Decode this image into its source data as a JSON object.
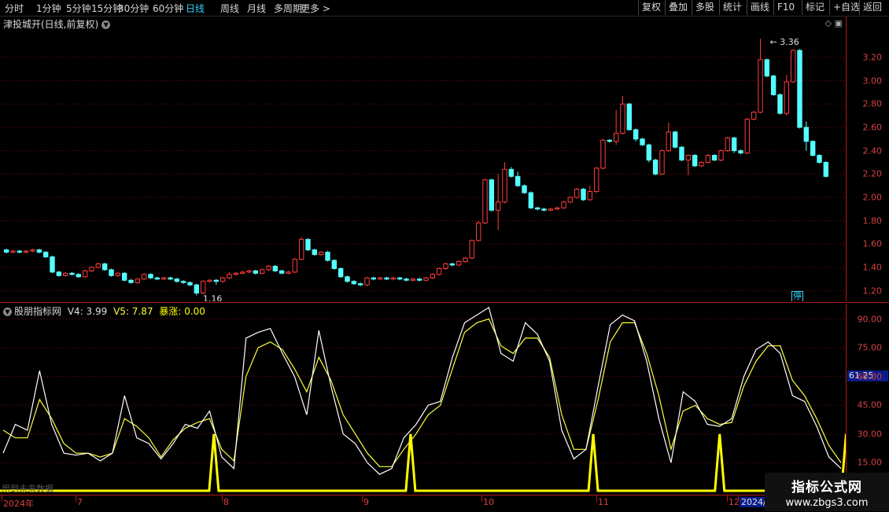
{
  "toolbar": {
    "periods": [
      "分时",
      "1分钟",
      "5分钟",
      "15分钟",
      "30分钟",
      "60分钟",
      "日线",
      "周线",
      "月线",
      "多周期",
      "更多 >"
    ],
    "active_period": "日线",
    "tools": [
      "复权",
      "叠加",
      "多股",
      "统计",
      "画线",
      "F10",
      "标记",
      "+自选",
      "返回"
    ]
  },
  "price_pane": {
    "stock_title": "津投城开(日线,前复权)",
    "stop_badge": "停",
    "high_label": "3.36",
    "low_label": "1.16",
    "icons": {
      "diamond": "diamond-icon",
      "window": "window-icon",
      "collapse": "chevron-down-icon"
    }
  },
  "price_axis": {
    "ticks": [
      "3.20",
      "3.00",
      "2.80",
      "2.60",
      "2.40",
      "2.20",
      "2.00",
      "1.80",
      "1.60",
      "1.40",
      "1.20"
    ],
    "tick_values": [
      3.2,
      3.0,
      2.8,
      2.6,
      2.4,
      2.2,
      2.0,
      1.8,
      1.6,
      1.4,
      1.2
    ],
    "range": [
      1.11,
      3.55
    ]
  },
  "indicator": {
    "name": "股朋指标网",
    "v4_label": "V4: 3.99",
    "v5_label": "V5: 7.87",
    "spike_label": "暴涨: 0.00",
    "footer_text": "用到未来数据",
    "current_value": "61.25",
    "ticks": [
      "90.00",
      "75.00",
      "60.00",
      "45.00",
      "30.00",
      "15.00"
    ],
    "tick_values": [
      90,
      75,
      60,
      45,
      30,
      15
    ],
    "range": [
      0,
      98
    ]
  },
  "dates": {
    "labels": [
      "2024年",
      "7",
      "8",
      "9",
      "10",
      "11",
      "12",
      "2024/"
    ],
    "positions_index": [
      0,
      19,
      56,
      91,
      124,
      160,
      198,
      200
    ]
  },
  "watermark": {
    "line1": "指标公式网",
    "line2": "www.zbgs3.com"
  },
  "colors": {
    "up": "#ff3c3c",
    "down": "#54ffff",
    "grid": "#7a0d0d",
    "axis_text": "#d84040",
    "white_line": "#ffffff",
    "yellow_line": "#ffff3a",
    "spike": "#ffff00",
    "active": "#38d4ff"
  },
  "chart_data": {
    "type": "candlestick",
    "title": "津投城开(日线,前复权)",
    "ylim": [
      1.11,
      3.55
    ],
    "candles": [
      [
        1.55,
        1.53,
        1.56,
        1.52
      ],
      [
        1.53,
        1.54,
        1.55,
        1.52
      ],
      [
        1.54,
        1.53,
        1.55,
        1.52
      ],
      [
        1.53,
        1.54,
        1.55,
        1.52
      ],
      [
        1.54,
        1.55,
        1.56,
        1.53
      ],
      [
        1.55,
        1.53,
        1.56,
        1.52
      ],
      [
        1.53,
        1.49,
        1.54,
        1.48
      ],
      [
        1.49,
        1.36,
        1.5,
        1.35
      ],
      [
        1.36,
        1.33,
        1.37,
        1.32
      ],
      [
        1.33,
        1.35,
        1.36,
        1.32
      ],
      [
        1.35,
        1.34,
        1.36,
        1.33
      ],
      [
        1.34,
        1.32,
        1.35,
        1.31
      ],
      [
        1.32,
        1.37,
        1.38,
        1.31
      ],
      [
        1.37,
        1.4,
        1.41,
        1.36
      ],
      [
        1.4,
        1.43,
        1.44,
        1.39
      ],
      [
        1.43,
        1.38,
        1.44,
        1.37
      ],
      [
        1.38,
        1.33,
        1.39,
        1.32
      ],
      [
        1.33,
        1.35,
        1.36,
        1.32
      ],
      [
        1.35,
        1.29,
        1.36,
        1.28
      ],
      [
        1.29,
        1.27,
        1.3,
        1.26
      ],
      [
        1.27,
        1.3,
        1.31,
        1.26
      ],
      [
        1.3,
        1.34,
        1.35,
        1.29
      ],
      [
        1.34,
        1.31,
        1.35,
        1.3
      ],
      [
        1.31,
        1.3,
        1.32,
        1.29
      ],
      [
        1.3,
        1.31,
        1.32,
        1.29
      ],
      [
        1.31,
        1.3,
        1.32,
        1.29
      ],
      [
        1.3,
        1.28,
        1.31,
        1.27
      ],
      [
        1.28,
        1.27,
        1.29,
        1.26
      ],
      [
        1.27,
        1.25,
        1.28,
        1.24
      ],
      [
        1.25,
        1.18,
        1.26,
        1.16
      ],
      [
        1.18,
        1.28,
        1.29,
        1.17
      ],
      [
        1.28,
        1.29,
        1.3,
        1.27
      ],
      [
        1.29,
        1.28,
        1.3,
        1.25
      ],
      [
        1.28,
        1.31,
        1.32,
        1.27
      ],
      [
        1.31,
        1.34,
        1.36,
        1.3
      ],
      [
        1.34,
        1.35,
        1.36,
        1.33
      ],
      [
        1.35,
        1.36,
        1.37,
        1.34
      ],
      [
        1.36,
        1.37,
        1.38,
        1.35
      ],
      [
        1.37,
        1.35,
        1.38,
        1.34
      ],
      [
        1.35,
        1.38,
        1.39,
        1.34
      ],
      [
        1.38,
        1.41,
        1.42,
        1.37
      ],
      [
        1.41,
        1.37,
        1.42,
        1.36
      ],
      [
        1.37,
        1.35,
        1.38,
        1.34
      ],
      [
        1.35,
        1.36,
        1.37,
        1.34
      ],
      [
        1.36,
        1.47,
        1.48,
        1.35
      ],
      [
        1.47,
        1.64,
        1.66,
        1.46
      ],
      [
        1.64,
        1.55,
        1.65,
        1.54
      ],
      [
        1.55,
        1.51,
        1.56,
        1.5
      ],
      [
        1.51,
        1.53,
        1.54,
        1.5
      ],
      [
        1.53,
        1.46,
        1.54,
        1.45
      ],
      [
        1.46,
        1.39,
        1.47,
        1.38
      ],
      [
        1.39,
        1.32,
        1.4,
        1.31
      ],
      [
        1.32,
        1.28,
        1.33,
        1.27
      ],
      [
        1.28,
        1.26,
        1.29,
        1.25
      ],
      [
        1.26,
        1.25,
        1.27,
        1.24
      ],
      [
        1.25,
        1.31,
        1.32,
        1.24
      ],
      [
        1.31,
        1.3,
        1.32,
        1.29
      ],
      [
        1.3,
        1.31,
        1.32,
        1.29
      ],
      [
        1.31,
        1.3,
        1.32,
        1.29
      ],
      [
        1.3,
        1.31,
        1.32,
        1.29
      ],
      [
        1.31,
        1.3,
        1.32,
        1.29
      ],
      [
        1.3,
        1.29,
        1.31,
        1.28
      ],
      [
        1.29,
        1.3,
        1.31,
        1.28
      ],
      [
        1.3,
        1.29,
        1.31,
        1.28
      ],
      [
        1.29,
        1.31,
        1.32,
        1.28
      ],
      [
        1.31,
        1.34,
        1.35,
        1.3
      ],
      [
        1.34,
        1.39,
        1.4,
        1.33
      ],
      [
        1.39,
        1.43,
        1.44,
        1.38
      ],
      [
        1.43,
        1.42,
        1.44,
        1.41
      ],
      [
        1.42,
        1.45,
        1.46,
        1.41
      ],
      [
        1.45,
        1.48,
        1.49,
        1.44
      ],
      [
        1.48,
        1.63,
        1.64,
        1.47
      ],
      [
        1.63,
        1.78,
        1.8,
        1.62
      ],
      [
        1.78,
        2.15,
        2.16,
        1.77
      ],
      [
        2.15,
        1.89,
        2.16,
        1.88
      ],
      [
        1.89,
        1.96,
        2.2,
        1.72
      ],
      [
        1.96,
        2.24,
        2.3,
        1.95
      ],
      [
        2.24,
        2.18,
        2.26,
        2.17
      ],
      [
        2.18,
        2.1,
        2.22,
        2.09
      ],
      [
        2.1,
        2.04,
        2.11,
        2.03
      ],
      [
        2.04,
        1.91,
        2.05,
        1.9
      ],
      [
        1.91,
        1.9,
        1.92,
        1.89
      ],
      [
        1.9,
        1.89,
        1.91,
        1.88
      ],
      [
        1.89,
        1.9,
        1.91,
        1.88
      ],
      [
        1.9,
        1.91,
        1.92,
        1.89
      ],
      [
        1.91,
        1.96,
        1.97,
        1.9
      ],
      [
        1.96,
        2.0,
        2.01,
        1.95
      ],
      [
        2.0,
        2.07,
        2.08,
        1.99
      ],
      [
        2.07,
        1.98,
        2.08,
        1.97
      ],
      [
        1.98,
        2.05,
        2.1,
        1.97
      ],
      [
        2.05,
        2.25,
        2.26,
        2.04
      ],
      [
        2.25,
        2.49,
        2.5,
        2.24
      ],
      [
        2.49,
        2.48,
        2.5,
        2.47
      ],
      [
        2.48,
        2.55,
        2.75,
        2.45
      ],
      [
        2.55,
        2.8,
        2.87,
        2.54
      ],
      [
        2.8,
        2.58,
        2.81,
        2.57
      ],
      [
        2.58,
        2.5,
        2.59,
        2.48
      ],
      [
        2.5,
        2.45,
        2.51,
        2.44
      ],
      [
        2.45,
        2.32,
        2.46,
        2.3
      ],
      [
        2.32,
        2.2,
        2.33,
        2.19
      ],
      [
        2.2,
        2.4,
        2.41,
        2.19
      ],
      [
        2.4,
        2.56,
        2.64,
        2.39
      ],
      [
        2.56,
        2.43,
        2.57,
        2.42
      ],
      [
        2.43,
        2.32,
        2.44,
        2.31
      ],
      [
        2.32,
        2.36,
        2.37,
        2.19
      ],
      [
        2.36,
        2.27,
        2.37,
        2.26
      ],
      [
        2.27,
        2.3,
        2.31,
        2.26
      ],
      [
        2.3,
        2.36,
        2.37,
        2.29
      ],
      [
        2.36,
        2.32,
        2.37,
        2.31
      ],
      [
        2.32,
        2.4,
        2.41,
        2.31
      ],
      [
        2.4,
        2.51,
        2.52,
        2.39
      ],
      [
        2.51,
        2.4,
        2.52,
        2.38
      ],
      [
        2.4,
        2.38,
        2.41,
        2.37
      ],
      [
        2.38,
        2.67,
        2.68,
        2.37
      ],
      [
        2.67,
        2.73,
        2.74,
        2.66
      ],
      [
        2.73,
        3.18,
        3.36,
        2.72
      ],
      [
        3.18,
        3.04,
        3.19,
        3.03
      ],
      [
        3.04,
        2.88,
        3.05,
        2.87
      ],
      [
        2.88,
        2.72,
        2.89,
        2.71
      ],
      [
        2.72,
        2.99,
        3.05,
        2.7
      ],
      [
        2.99,
        3.26,
        3.27,
        2.98
      ],
      [
        3.26,
        2.6,
        3.27,
        2.59
      ],
      [
        2.6,
        2.48,
        2.65,
        2.4
      ],
      [
        2.48,
        2.36,
        2.49,
        2.35
      ],
      [
        2.36,
        2.3,
        2.37,
        2.29
      ],
      [
        2.3,
        2.18,
        2.31,
        2.17
      ]
    ],
    "indicator_series": [
      {
        "name": "V4",
        "color": "white",
        "values": [
          20,
          35,
          32,
          63,
          35,
          20,
          19,
          20,
          16,
          20,
          50,
          28,
          25,
          17,
          25,
          35,
          33,
          42,
          18,
          12,
          80,
          83,
          85,
          72,
          60,
          40,
          84,
          55,
          30,
          25,
          15,
          9,
          12,
          28,
          35,
          45,
          47,
          70,
          88,
          92,
          96,
          72,
          68,
          88,
          82,
          68,
          32,
          17,
          22,
          55,
          87,
          92,
          89,
          68,
          38,
          15,
          52,
          47,
          35,
          34,
          38,
          60,
          74,
          78,
          72,
          50,
          47,
          34,
          18,
          12
        ]
      },
      {
        "name": "V5",
        "color": "yellow",
        "values": [
          32,
          28,
          28,
          48,
          38,
          25,
          20,
          20,
          18,
          20,
          38,
          34,
          28,
          18,
          27,
          33,
          36,
          38,
          22,
          16,
          60,
          75,
          78,
          74,
          64,
          52,
          70,
          58,
          40,
          30,
          20,
          13,
          13,
          22,
          30,
          40,
          45,
          64,
          83,
          88,
          90,
          76,
          72,
          80,
          80,
          70,
          40,
          22,
          22,
          48,
          78,
          88,
          88,
          72,
          50,
          22,
          42,
          45,
          38,
          35,
          36,
          55,
          68,
          76,
          76,
          58,
          50,
          38,
          24,
          15
        ]
      },
      {
        "name": "暴涨",
        "color": "yellow",
        "spike_indices": [
          15,
          29,
          42,
          51,
          60
        ],
        "spike_height": 30
      }
    ]
  }
}
